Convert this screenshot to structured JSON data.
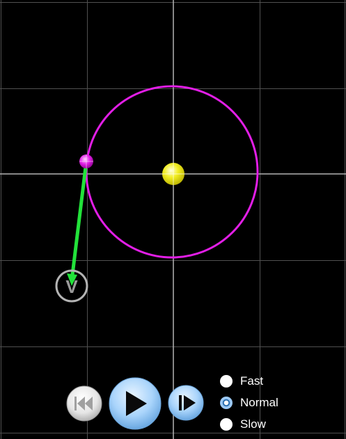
{
  "simulation": {
    "orbit_color": "#e21ee6",
    "sun_color": "#f2ee22",
    "planet_color": "#e21ee6",
    "velocity_vector_color": "#22e23a",
    "grid_color": "#505050",
    "axis_color": "#b4b4b4",
    "velocity_label": "V"
  },
  "controls": {
    "reset_icon": "skip-to-start-icon",
    "play_icon": "play-icon",
    "step_icon": "step-forward-icon"
  },
  "speed": {
    "options": [
      {
        "label": "Fast",
        "selected": false
      },
      {
        "label": "Normal",
        "selected": true
      },
      {
        "label": "Slow",
        "selected": false
      }
    ]
  }
}
